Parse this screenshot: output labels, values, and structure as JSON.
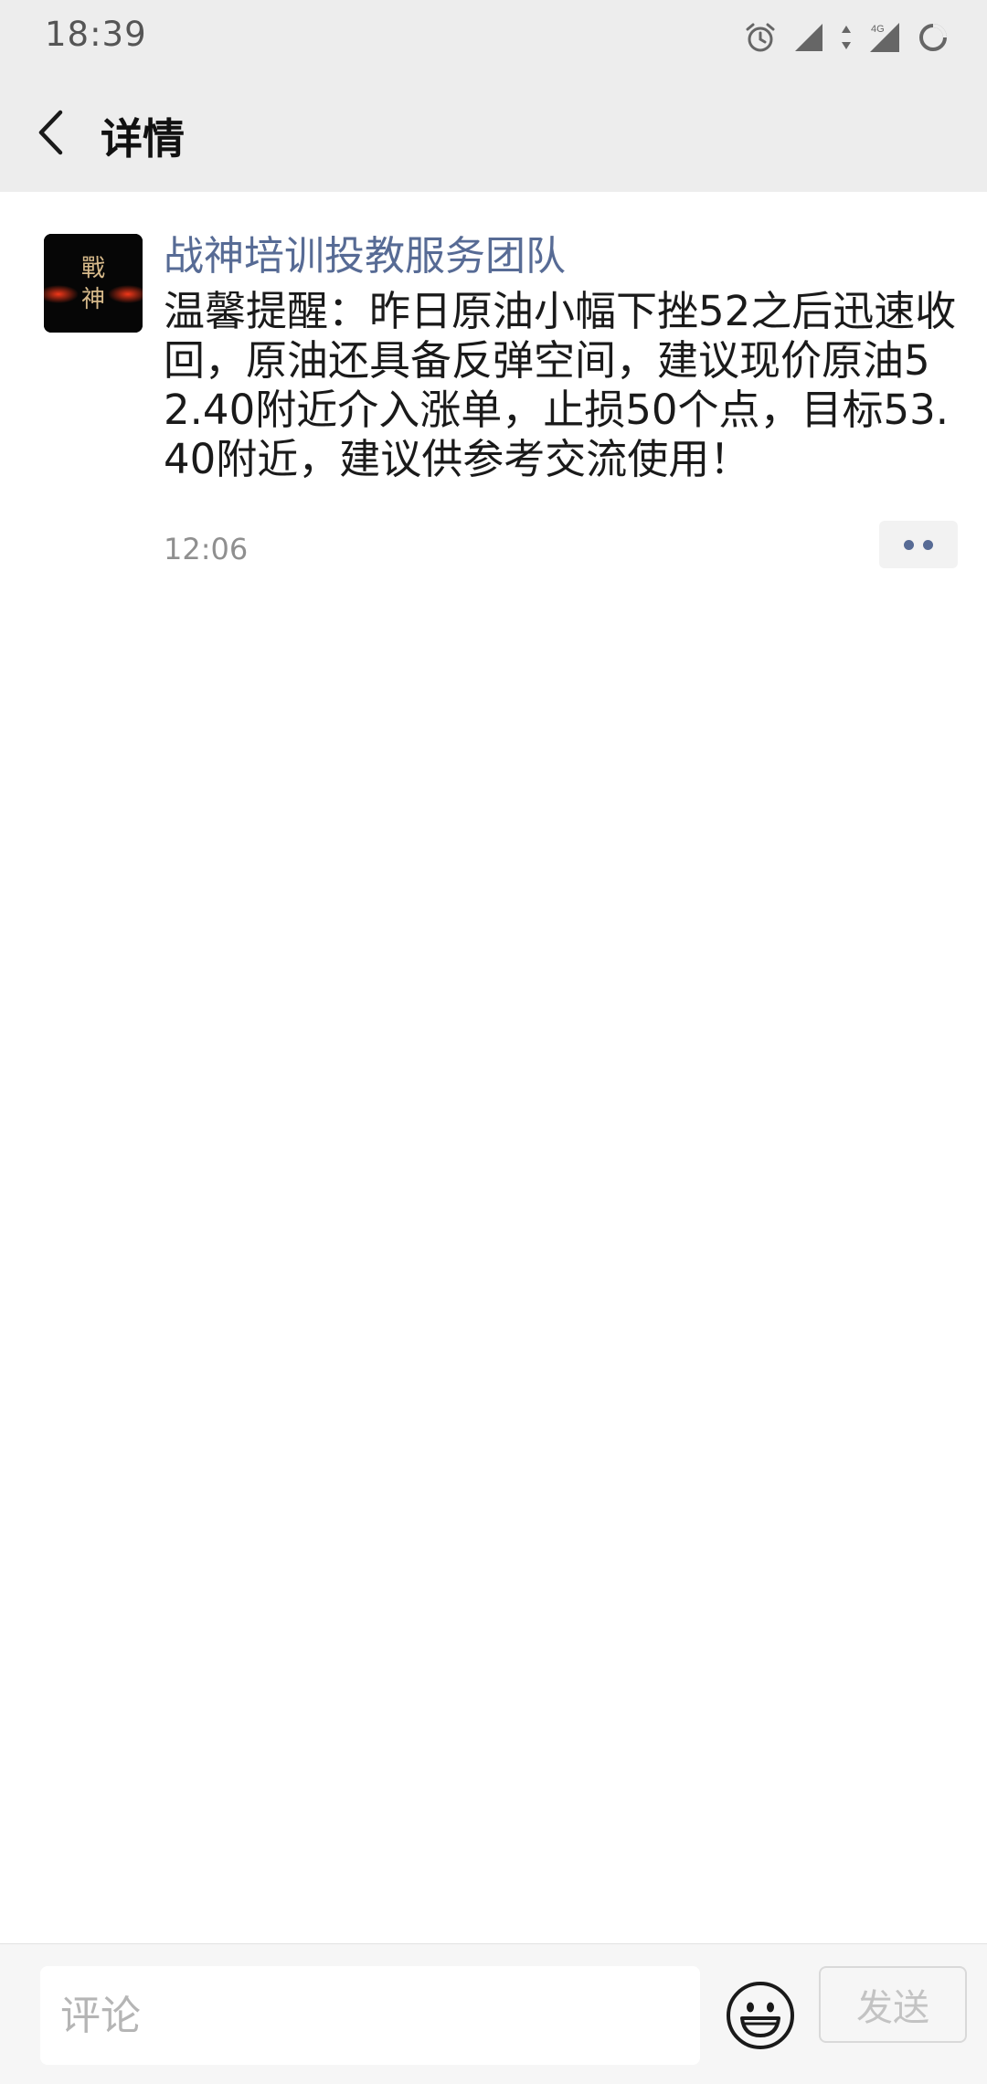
{
  "status_bar": {
    "time": "18:39",
    "network_label": "4G",
    "icons": [
      "alarm-icon",
      "signal-icon",
      "data-arrows-icon",
      "signal-4g-icon",
      "loading-icon"
    ]
  },
  "nav": {
    "back_icon": "chevron-left-icon",
    "title": "详情"
  },
  "post": {
    "avatar": {
      "text_top": "戰",
      "text_bottom": "神"
    },
    "author": "战神培训投教服务团队",
    "text": "温馨提醒：昨日原油小幅下挫52之后迅速收回，原油还具备反弹空间，建议现价原油52.40附近介入涨单，止损50个点，目标53.40附近，建议供参考交流使用！",
    "time": "12:06",
    "more_icon": "more-dots-icon"
  },
  "comment_bar": {
    "placeholder": "评论",
    "value": "",
    "emoji_icon": "emoji-icon",
    "send_label": "发送"
  },
  "colors": {
    "header_bg": "#ededed",
    "author_link": "#576b95",
    "send_disabled": "#c3c3c3"
  }
}
